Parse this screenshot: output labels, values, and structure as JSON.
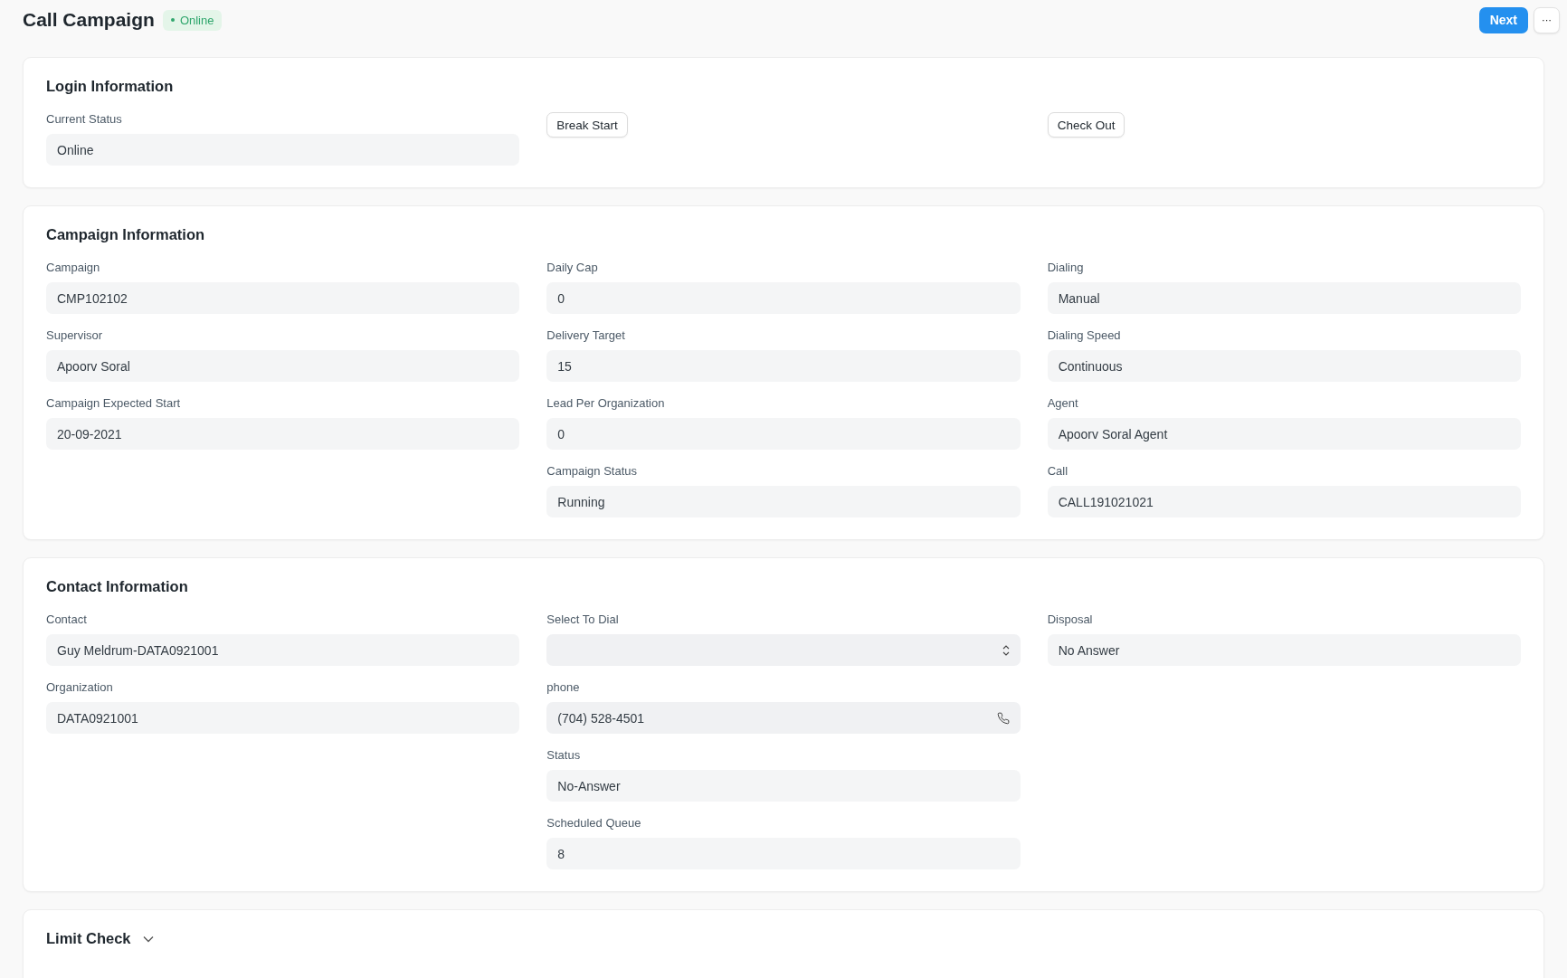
{
  "header": {
    "title": "Call Campaign",
    "status_badge": "Online",
    "actions": [
      {
        "kind": "primary",
        "label": "Next"
      },
      {
        "kind": "menu",
        "label": "···"
      }
    ]
  },
  "sections": [
    {
      "title": "Login Information",
      "expanded": true,
      "columns": [
        [
          {
            "kind": "field",
            "label": "Current Status",
            "value": "Online"
          }
        ],
        [
          {
            "kind": "button",
            "label": "Break Start"
          }
        ],
        [
          {
            "kind": "button",
            "label": "Check Out"
          }
        ]
      ]
    },
    {
      "title": "Campaign Information",
      "expanded": true,
      "columns": [
        [
          {
            "kind": "field",
            "label": "Campaign",
            "value": "CMP102102"
          },
          {
            "kind": "field",
            "label": "Supervisor",
            "value": "Apoorv Soral"
          },
          {
            "kind": "field",
            "label": "Campaign Expected Start",
            "value": "20-09-2021"
          }
        ],
        [
          {
            "kind": "field",
            "label": "Daily Cap",
            "value": "0"
          },
          {
            "kind": "field",
            "label": "Delivery Target",
            "value": "15"
          },
          {
            "kind": "field",
            "label": "Lead Per Organization",
            "value": "0"
          },
          {
            "kind": "field",
            "label": "Campaign Status",
            "value": "Running"
          }
        ],
        [
          {
            "kind": "field",
            "label": "Dialing",
            "value": "Manual"
          },
          {
            "kind": "field",
            "label": "Dialing Speed",
            "value": "Continuous"
          },
          {
            "kind": "field",
            "label": "Agent",
            "value": "Apoorv Soral Agent"
          },
          {
            "kind": "field",
            "label": "Call",
            "value": "CALL191021021"
          }
        ]
      ]
    },
    {
      "title": "Contact Information",
      "expanded": true,
      "columns": [
        [
          {
            "kind": "field",
            "label": "Contact",
            "value": "Guy Meldrum-DATA0921001"
          },
          {
            "kind": "field",
            "label": "Organization",
            "value": "DATA0921001"
          }
        ],
        [
          {
            "kind": "select",
            "label": "Select To Dial"
          },
          {
            "kind": "phone",
            "label": "phone",
            "value": "(704) 528-4501"
          },
          {
            "kind": "field",
            "label": "Status",
            "value": "No-Answer"
          },
          {
            "kind": "field",
            "label": "Scheduled Queue",
            "value": "8"
          }
        ],
        [
          {
            "kind": "field",
            "label": "Disposal",
            "value": "No Answer"
          }
        ]
      ]
    },
    {
      "title": "Limit Check",
      "expanded": false
    }
  ]
}
